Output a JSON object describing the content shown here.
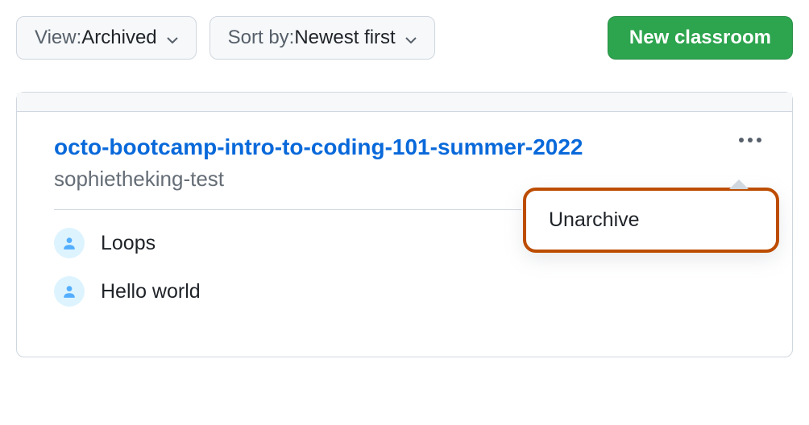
{
  "toolbar": {
    "view": {
      "prefix": "View: ",
      "value": "Archived"
    },
    "sort": {
      "prefix": "Sort by: ",
      "value": "Newest first"
    },
    "new_classroom_label": "New classroom"
  },
  "classroom": {
    "title": "octo-bootcamp-intro-to-coding-101-summer-2022",
    "org": "sophietheking-test",
    "assignments": [
      {
        "name": "Loops"
      },
      {
        "name": "Hello world"
      }
    ]
  },
  "menu": {
    "unarchive_label": "Unarchive"
  }
}
